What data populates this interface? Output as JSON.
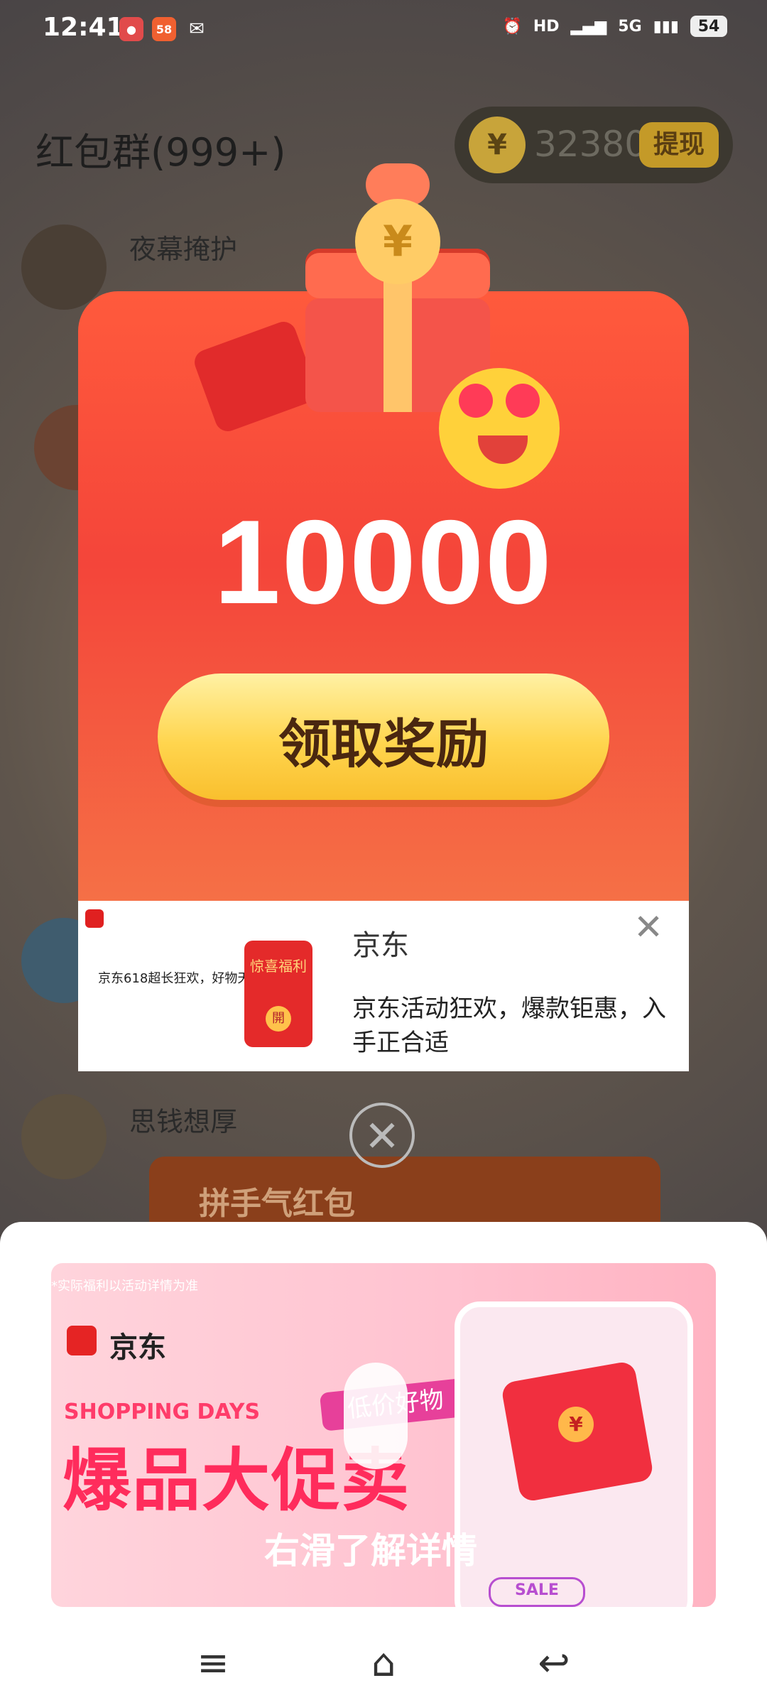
{
  "status_bar": {
    "time": "12:41",
    "left_icons": [
      "app-notification-icon",
      "58-app-icon",
      "wechat-icon"
    ],
    "badge_58": "58",
    "right_indicators": [
      "alarm-icon",
      "HD",
      "signal-icon",
      "5G",
      "wifi-icon"
    ],
    "hd": "HD",
    "network": "5G",
    "battery": "54"
  },
  "background": {
    "title": "红包群(999+)",
    "coin_icon": "¥",
    "coins": "32380",
    "withdraw_label": "提现",
    "members": [
      "夜幕掩护",
      "思钱想厚"
    ],
    "bubble_text": "拼手气红包"
  },
  "reward_popup": {
    "amount": "10000",
    "claim_button": "领取奖励",
    "gift_coin_symbol": "¥"
  },
  "popup_ad": {
    "left_text": "京东618超长狂欢，好物天天低价",
    "envelope_label": "惊喜福利",
    "envelope_seal": "開",
    "title": "京东",
    "description": "京东活动狂欢，爆款钜惠，入手正合适",
    "close_icon": "close-icon"
  },
  "popup_close_icon": "close-circle-icon",
  "bottom_banner": {
    "disclaimer": "*实际福利以活动详情为准",
    "brand": "京东",
    "shopping_days": "SHOPPING DAYS",
    "headline": "爆品大促卖",
    "tag": "低价好物",
    "swipe_hint": "右滑了解详情",
    "sale": "SALE",
    "coin_symbol": "¥"
  },
  "nav_bar": {
    "menu_icon": "≡",
    "home_icon": "⌂",
    "back_icon": "↩"
  },
  "colors": {
    "popup_red": "#f4453a",
    "claim_yellow": "#ffd54e",
    "banner_pink": "#ffc2d0",
    "headline_pink": "#ff2c5c"
  }
}
